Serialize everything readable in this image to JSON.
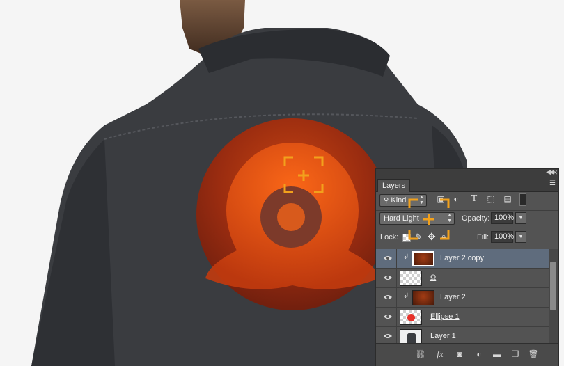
{
  "panel": {
    "tab_label": "Layers",
    "filter": {
      "kind_label": "Kind",
      "icons": [
        "image-filter-icon",
        "adjustment-filter-icon",
        "type-filter-icon",
        "shape-filter-icon",
        "smart-object-filter-icon",
        "filter-toggle-icon"
      ]
    },
    "blend_mode": "Hard Light",
    "opacity_label": "Opacity:",
    "opacity_value": "100%",
    "lock_label": "Lock:",
    "fill_label": "Fill:",
    "fill_value": "100%",
    "layers": [
      {
        "name": "Layer 2 copy",
        "visible": true,
        "clipped": true,
        "thumb": "texture",
        "selected": true
      },
      {
        "name": "Ω",
        "visible": true,
        "clipped": false,
        "thumb": "transparent",
        "selected": false
      },
      {
        "name": "Layer 2",
        "visible": true,
        "clipped": true,
        "thumb": "texture",
        "selected": false
      },
      {
        "name": "Ellipse 1",
        "visible": true,
        "clipped": false,
        "thumb": "ellipse",
        "selected": false
      },
      {
        "name": "Layer 1",
        "visible": true,
        "clipped": false,
        "thumb": "photo",
        "selected": false
      }
    ],
    "bottom_icons": [
      "link-layers-icon",
      "fx-icon",
      "add-mask-icon",
      "adjustment-layer-icon",
      "new-group-icon",
      "new-layer-icon",
      "trash-icon"
    ],
    "fx_label": "fx"
  },
  "colors": {
    "accent_orange": "#f2a11c",
    "panel_bg": "#535353",
    "selected_row": "#5f6c7d"
  }
}
